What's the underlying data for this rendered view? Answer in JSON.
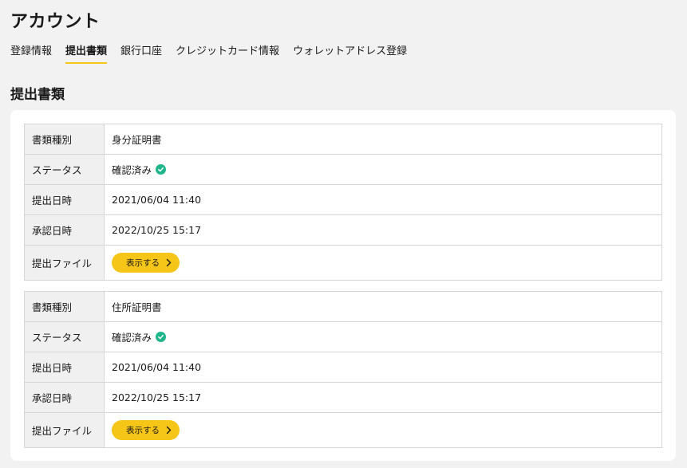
{
  "page": {
    "title": "アカウント"
  },
  "tabs": [
    {
      "label": "登録情報",
      "active": false
    },
    {
      "label": "提出書類",
      "active": true
    },
    {
      "label": "銀行口座",
      "active": false
    },
    {
      "label": "クレジットカード情報",
      "active": false
    },
    {
      "label": "ウォレットアドレス登録",
      "active": false
    }
  ],
  "section": {
    "title": "提出書類"
  },
  "labels": {
    "doc_type": "書類種別",
    "status": "ステータス",
    "submitted_at": "提出日時",
    "approved_at": "承認日時",
    "file": "提出ファイル"
  },
  "documents": [
    {
      "doc_type": "身分証明書",
      "status": "確認済み",
      "submitted_at": "2021/06/04 11:40",
      "approved_at": "2022/10/25 15:17",
      "view_label": "表示する"
    },
    {
      "doc_type": "住所証明書",
      "status": "確認済み",
      "submitted_at": "2021/06/04 11:40",
      "approved_at": "2022/10/25 15:17",
      "view_label": "表示する"
    }
  ],
  "colors": {
    "accent": "#f5c518",
    "status_ok": "#1fb68c",
    "background": "#f2f2f2",
    "label_bg": "#f0f0f0"
  },
  "icons": {
    "status": "check-circle-icon",
    "view": "chevron-right-icon"
  }
}
